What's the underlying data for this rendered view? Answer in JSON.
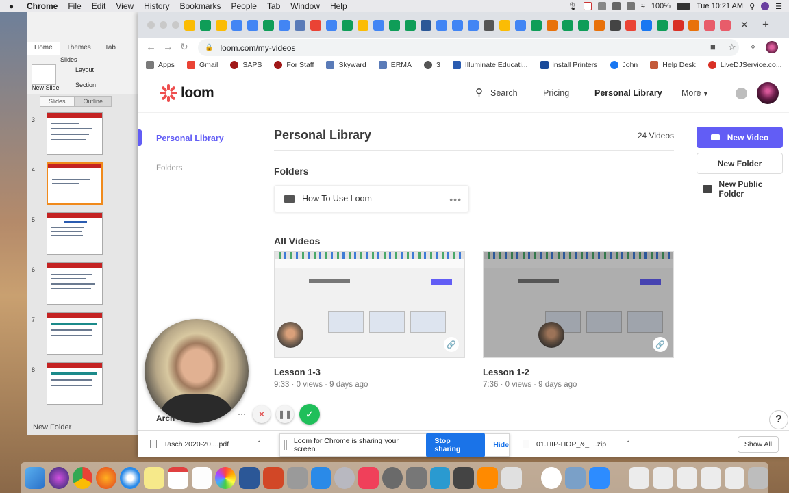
{
  "menubar": {
    "app": "Chrome",
    "items": [
      "File",
      "Edit",
      "View",
      "History",
      "Bookmarks",
      "People",
      "Tab",
      "Window",
      "Help"
    ],
    "battery": "100%",
    "clock": "Tue 10:21 AM"
  },
  "powerpoint": {
    "tabs": [
      "Home",
      "Themes",
      "Tab"
    ],
    "ribbon": {
      "new_slide": "New Slide",
      "layout": "Layout",
      "section": "Section",
      "slides_group": "Slides"
    },
    "pane_tabs": [
      "Slides",
      "Outline"
    ],
    "slide_numbers": [
      "3",
      "4",
      "5",
      "6",
      "7",
      "8"
    ],
    "new_folder": "New Folder"
  },
  "chrome": {
    "url": "loom.com/my-videos",
    "bookmarks": [
      "Apps",
      "Gmail",
      "SAPS",
      "For Staff",
      "Skyward",
      "ERMA",
      "3",
      "Illuminate Educati...",
      "install Printers",
      "John",
      "Help Desk",
      "LiveDJService.co..."
    ],
    "favicon_colors": [
      "#fbbc04",
      "#0f9d58",
      "#fbbc04",
      "#4285f4",
      "#4285f4",
      "#0f9d58",
      "#4285f4",
      "#5a7bb8",
      "#ea4335",
      "#4285f4",
      "#0f9d58",
      "#fbbc04",
      "#4285f4",
      "#0f9d58",
      "#0f9d58",
      "#2b5797",
      "#4285f4",
      "#4285f4",
      "#4285f4",
      "#555555",
      "#fbbc04",
      "#4285f4",
      "#0f9d58",
      "#e8710a",
      "#0f9d58",
      "#0f9d58",
      "#e8710a",
      "#444444",
      "#ea4335",
      "#1877f2",
      "#0f9d58",
      "#d93025",
      "#e8710a",
      "#e85c6a",
      "#e85c6a"
    ]
  },
  "loom": {
    "logo": "loom",
    "nav": {
      "search": "Search",
      "pricing": "Pricing",
      "library": "Personal Library",
      "more": "More"
    },
    "sidebar": {
      "active": "Personal Library",
      "folders": "Folders"
    },
    "page_title": "Personal Library",
    "video_count": "24 Videos",
    "folders_heading": "Folders",
    "folder": {
      "name": "How To Use Loom"
    },
    "videos_heading": "All Videos",
    "videos": [
      {
        "title": "Lesson 1-3",
        "meta": "9:33 · 0 views · 9 days ago"
      },
      {
        "title": "Lesson 1-2",
        "meta": "7:36 · 0 views · 9 days ago"
      }
    ],
    "actions": {
      "new_video": "New Video",
      "new_folder": "New Folder",
      "new_public_folder": "New Public Folder"
    },
    "overlay_label": "Arch",
    "help": "?"
  },
  "downloads": {
    "items": [
      "Tasch 2020-20....pdf",
      "01.HIP-HOP_&_....zip"
    ],
    "show_all": "Show All"
  },
  "sharing": {
    "message": "Loom for Chrome is sharing your screen.",
    "stop": "Stop sharing",
    "hide": "Hide"
  },
  "colors": {
    "loom_purple": "#625df5",
    "loom_red": "#ee4f4f",
    "record_green": "#1fbf5a"
  }
}
